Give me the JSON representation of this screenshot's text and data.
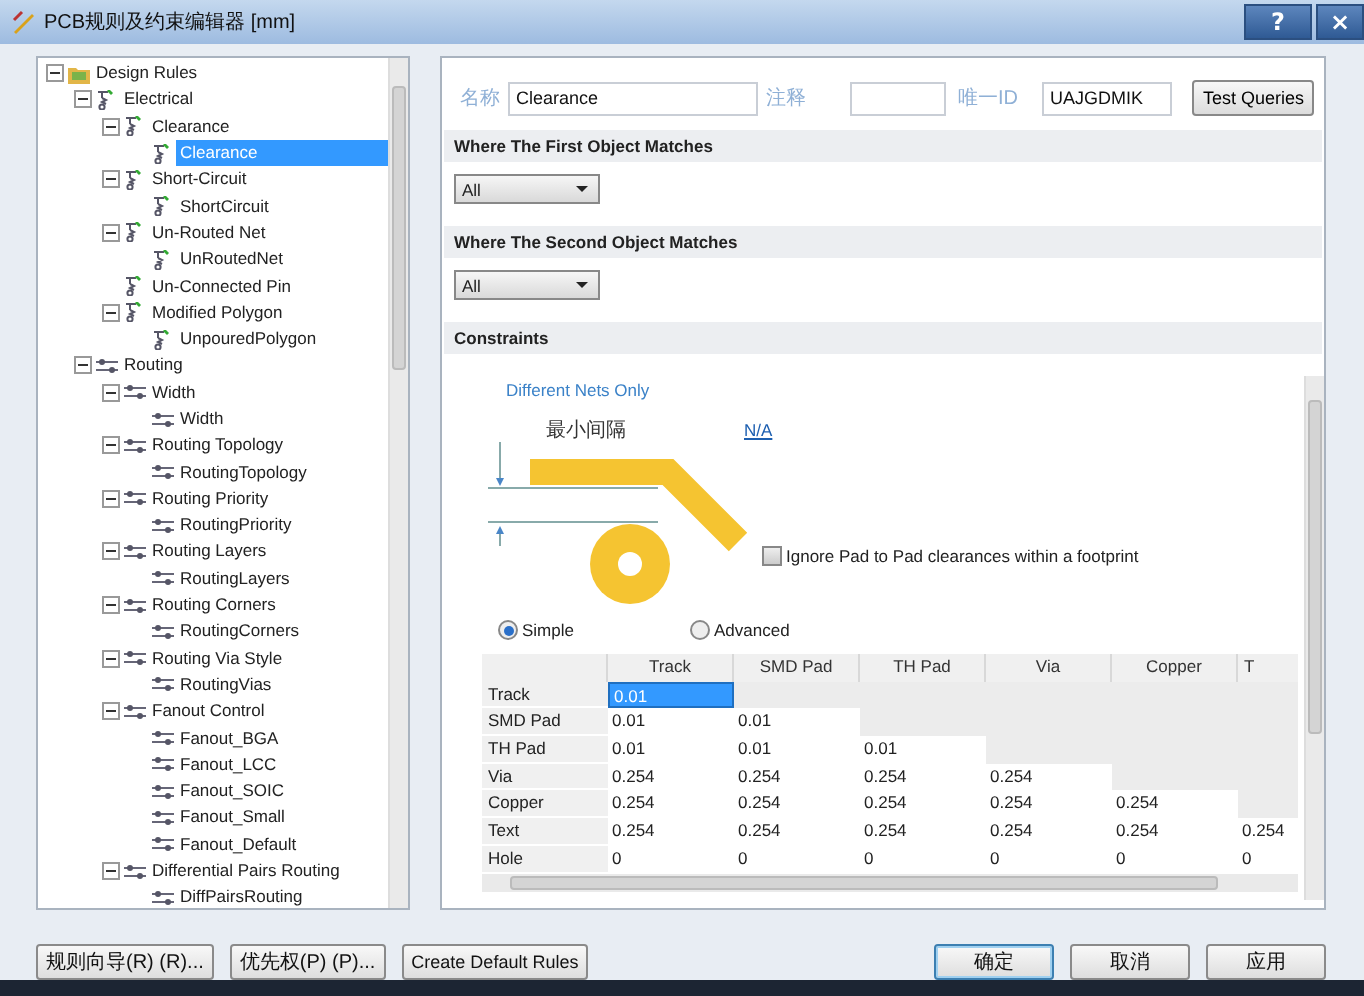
{
  "window": {
    "title": "PCB规则及约束编辑器 [mm]",
    "buttons": [
      "?",
      "×"
    ]
  },
  "tree": {
    "items": [
      {
        "label": "Design Rules",
        "kind": "folder",
        "selected": false,
        "expanded": true,
        "children": [
          {
            "label": "Electrical",
            "kind": "electrical",
            "selected": false,
            "expanded": true,
            "children": [
              {
                "label": "Clearance",
                "kind": "electrical",
                "selected": false,
                "expanded": true,
                "children": [
                  {
                    "label": "Clearance",
                    "kind": "electrical",
                    "selected": true
                  }
                ]
              },
              {
                "label": "Short-Circuit",
                "kind": "electrical",
                "selected": false,
                "expanded": true,
                "children": [
                  {
                    "label": "ShortCircuit",
                    "kind": "electrical",
                    "selected": false
                  }
                ]
              },
              {
                "label": "Un-Routed Net",
                "kind": "electrical",
                "selected": false,
                "expanded": true,
                "children": [
                  {
                    "label": "UnRoutedNet",
                    "kind": "electrical",
                    "selected": false
                  }
                ]
              },
              {
                "label": "Un-Connected Pin",
                "kind": "electrical",
                "selected": false
              },
              {
                "label": "Modified Polygon",
                "kind": "electrical",
                "selected": false,
                "expanded": true,
                "children": [
                  {
                    "label": "UnpouredPolygon",
                    "kind": "electrical",
                    "selected": false
                  }
                ]
              }
            ]
          },
          {
            "label": "Routing",
            "kind": "routing",
            "selected": false,
            "expanded": true,
            "children": [
              {
                "label": "Width",
                "kind": "routing",
                "selected": false,
                "expanded": true,
                "children": [
                  {
                    "label": "Width",
                    "kind": "routing",
                    "selected": false
                  }
                ]
              },
              {
                "label": "Routing Topology",
                "kind": "routing",
                "selected": false,
                "expanded": true,
                "children": [
                  {
                    "label": "RoutingTopology",
                    "kind": "routing",
                    "selected": false
                  }
                ]
              },
              {
                "label": "Routing Priority",
                "kind": "routing",
                "selected": false,
                "expanded": true,
                "children": [
                  {
                    "label": "RoutingPriority",
                    "kind": "routing",
                    "selected": false
                  }
                ]
              },
              {
                "label": "Routing Layers",
                "kind": "routing",
                "selected": false,
                "expanded": true,
                "children": [
                  {
                    "label": "RoutingLayers",
                    "kind": "routing",
                    "selected": false
                  }
                ]
              },
              {
                "label": "Routing Corners",
                "kind": "routing",
                "selected": false,
                "expanded": true,
                "children": [
                  {
                    "label": "RoutingCorners",
                    "kind": "routing",
                    "selected": false
                  }
                ]
              },
              {
                "label": "Routing Via Style",
                "kind": "routing",
                "selected": false,
                "expanded": true,
                "children": [
                  {
                    "label": "RoutingVias",
                    "kind": "routing",
                    "selected": false
                  }
                ]
              },
              {
                "label": "Fanout Control",
                "kind": "routing",
                "selected": false,
                "expanded": true,
                "children": [
                  {
                    "label": "Fanout_BGA",
                    "kind": "routing",
                    "selected": false
                  },
                  {
                    "label": "Fanout_LCC",
                    "kind": "routing",
                    "selected": false
                  },
                  {
                    "label": "Fanout_SOIC",
                    "kind": "routing",
                    "selected": false
                  },
                  {
                    "label": "Fanout_Small",
                    "kind": "routing",
                    "selected": false
                  },
                  {
                    "label": "Fanout_Default",
                    "kind": "routing",
                    "selected": false
                  }
                ]
              },
              {
                "label": "Differential Pairs Routing",
                "kind": "routing",
                "selected": false,
                "expanded": true,
                "children": [
                  {
                    "label": "DiffPairsRouting",
                    "kind": "routing",
                    "selected": false
                  }
                ]
              }
            ]
          }
        ]
      }
    ]
  },
  "rule": {
    "name": {
      "label": "名称",
      "value": "Clearance"
    },
    "comment": {
      "label": "注释"
    },
    "unique_id": {
      "label": "唯一ID",
      "value": "UAJGDMIK"
    },
    "test_button": "Test Queries"
  },
  "first_match": {
    "title": "Where The First Object Matches",
    "select": "All"
  },
  "second_match": {
    "title": "Where The Second Object Matches",
    "select": "All"
  },
  "constraints": {
    "title": "Constraints",
    "net_scope": "Different Nets Only",
    "clearance_label": "最小间隔",
    "clearance_link": "N/A",
    "ignore_pad": {
      "label": "Ignore Pad to Pad clearances within a footprint",
      "checked": false
    },
    "modes": [
      {
        "label": "Simple",
        "selected": true
      },
      {
        "label": "Advanced",
        "selected": false
      }
    ],
    "matrix": {
      "columns": [
        "Track",
        "SMD Pad",
        "TH Pad",
        "Via",
        "Copper",
        "T"
      ],
      "rows": [
        {
          "label": "Track",
          "cells": [
            {
              "text": "0.01",
              "selected": true
            }
          ]
        },
        {
          "label": "SMD Pad",
          "cells": [
            {
              "text": "0.01",
              "selected": false
            },
            {
              "text": "0.01",
              "selected": false
            }
          ]
        },
        {
          "label": "TH Pad",
          "cells": [
            {
              "text": "0.01",
              "selected": false
            },
            {
              "text": "0.01",
              "selected": false
            },
            {
              "text": "0.01",
              "selected": false
            }
          ]
        },
        {
          "label": "Via",
          "cells": [
            {
              "text": "0.254",
              "selected": false
            },
            {
              "text": "0.254",
              "selected": false
            },
            {
              "text": "0.254",
              "selected": false
            },
            {
              "text": "0.254",
              "selected": false
            }
          ]
        },
        {
          "label": "Copper",
          "cells": [
            {
              "text": "0.254",
              "selected": false
            },
            {
              "text": "0.254",
              "selected": false
            },
            {
              "text": "0.254",
              "selected": false
            },
            {
              "text": "0.254",
              "selected": false
            },
            {
              "text": "0.254",
              "selected": false
            }
          ]
        },
        {
          "label": "Text",
          "cells": [
            {
              "text": "0.254",
              "selected": false
            },
            {
              "text": "0.254",
              "selected": false
            },
            {
              "text": "0.254",
              "selected": false
            },
            {
              "text": "0.254",
              "selected": false
            },
            {
              "text": "0.254",
              "selected": false
            },
            {
              "text": "0.254",
              "selected": false
            }
          ]
        },
        {
          "label": "Hole",
          "cells": [
            {
              "text": "0",
              "selected": false
            },
            {
              "text": "0",
              "selected": false
            },
            {
              "text": "0",
              "selected": false
            },
            {
              "text": "0",
              "selected": false
            },
            {
              "text": "0",
              "selected": false
            },
            {
              "text": "0",
              "selected": false
            }
          ]
        }
      ]
    }
  },
  "footer": {
    "left_buttons": [
      "规则向导(R) (R)...",
      "优先权(P) (P)...",
      "Create Default Rules"
    ],
    "right_buttons": [
      {
        "label": "确定",
        "default": true
      },
      {
        "label": "取消",
        "default": false
      },
      {
        "label": "应用",
        "default": false
      }
    ]
  }
}
